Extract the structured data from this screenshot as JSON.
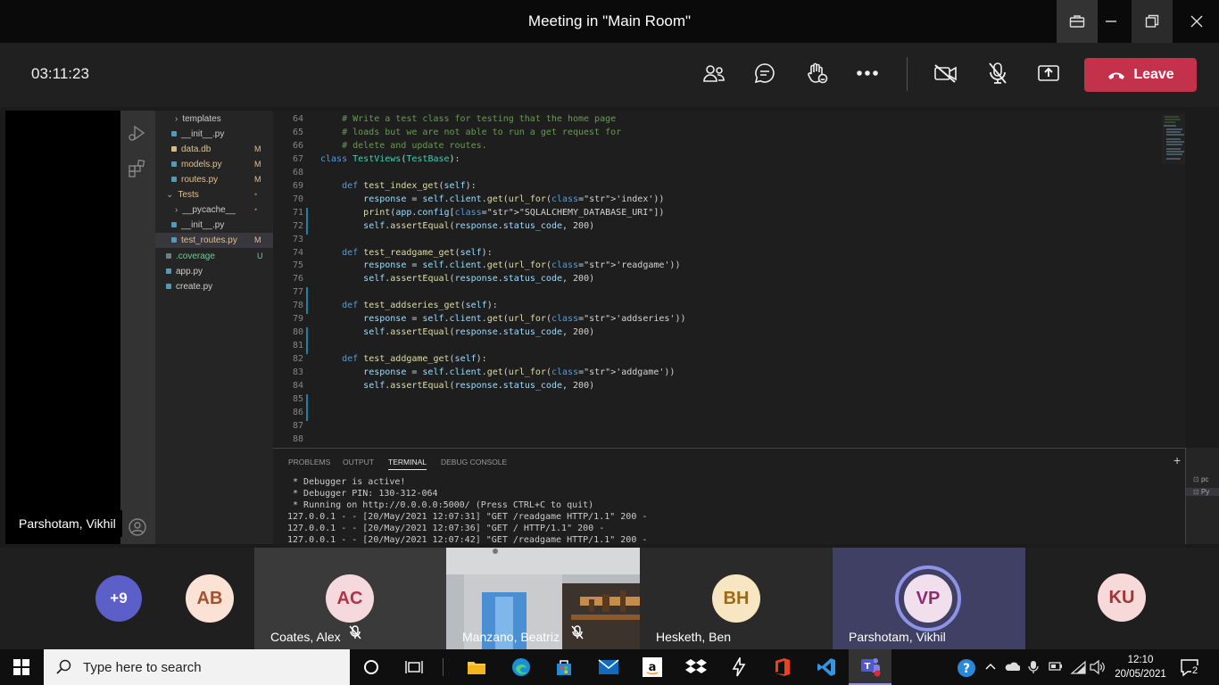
{
  "window": {
    "title": "Meeting in \"Main Room\""
  },
  "controls": {
    "timer": "03:11:23",
    "leave_label": "Leave"
  },
  "presenter": {
    "name": "Parshotam, Vikhil"
  },
  "explorer": {
    "items": [
      {
        "label": "templates",
        "badge": ""
      },
      {
        "label": "__init__.py",
        "badge": ""
      },
      {
        "label": "data.db",
        "badge": "M"
      },
      {
        "label": "models.py",
        "badge": "M"
      },
      {
        "label": "routes.py",
        "badge": "M"
      },
      {
        "label": "Tests",
        "badge": "•"
      },
      {
        "label": "__pycache__",
        "badge": "•"
      },
      {
        "label": "__init__.py",
        "badge": ""
      },
      {
        "label": "test_routes.py",
        "badge": "M"
      },
      {
        "label": ".coverage",
        "badge": "U"
      },
      {
        "label": "app.py",
        "badge": ""
      },
      {
        "label": "create.py",
        "badge": ""
      }
    ]
  },
  "editor": {
    "lines": [
      {
        "n": "64",
        "text": "    # Write a test class for testing that the home page"
      },
      {
        "n": "65",
        "text": "    # loads but we are not able to run a get request for"
      },
      {
        "n": "66",
        "text": "    # delete and update routes."
      },
      {
        "n": "67",
        "text": "class TestViews(TestBase):"
      },
      {
        "n": "68",
        "text": ""
      },
      {
        "n": "69",
        "text": "    def test_index_get(self):"
      },
      {
        "n": "70",
        "text": "        response = self.client.get(url_for('index'))"
      },
      {
        "n": "71",
        "text": "        print(app.config[\"SQLALCHEMY_DATABASE_URI\"])"
      },
      {
        "n": "72",
        "text": "        self.assertEqual(response.status_code, 200)"
      },
      {
        "n": "73",
        "text": ""
      },
      {
        "n": "74",
        "text": "    def test_readgame_get(self):"
      },
      {
        "n": "75",
        "text": "        response = self.client.get(url_for('readgame'))"
      },
      {
        "n": "76",
        "text": "        self.assertEqual(response.status_code, 200)"
      },
      {
        "n": "77",
        "text": ""
      },
      {
        "n": "78",
        "text": "    def test_addseries_get(self):"
      },
      {
        "n": "79",
        "text": "        response = self.client.get(url_for('addseries'))"
      },
      {
        "n": "80",
        "text": "        self.assertEqual(response.status_code, 200)"
      },
      {
        "n": "81",
        "text": ""
      },
      {
        "n": "82",
        "text": "    def test_addgame_get(self):"
      },
      {
        "n": "83",
        "text": "        response = self.client.get(url_for('addgame'))"
      },
      {
        "n": "84",
        "text": "        self.assertEqual(response.status_code, 200)"
      },
      {
        "n": "85",
        "text": ""
      },
      {
        "n": "86",
        "text": ""
      },
      {
        "n": "87",
        "text": ""
      },
      {
        "n": "88",
        "text": ""
      }
    ]
  },
  "panel": {
    "tabs": [
      "PROBLEMS",
      "OUTPUT",
      "TERMINAL",
      "DEBUG CONSOLE"
    ],
    "active_tab": "TERMINAL",
    "terminal": [
      " * Debugger is active!",
      " * Debugger PIN: 130-312-064",
      " * Running on http://0.0.0.0:5000/ (Press CTRL+C to quit)",
      "127.0.0.1 - - [20/May/2021 12:07:31] \"GET /readgame HTTP/1.1\" 200 -",
      "127.0.0.1 - - [20/May/2021 12:07:36] \"GET / HTTP/1.1\" 200 -",
      "127.0.0.1 - - [20/May/2021 12:07:42] \"GET /readgame HTTP/1.1\" 200 -"
    ],
    "side_labels": [
      "pc",
      "Py"
    ]
  },
  "gallery": {
    "overflow": "+9",
    "participants": [
      {
        "initials": "AB",
        "name": ""
      },
      {
        "initials": "AC",
        "name": "Coates, Alex"
      },
      {
        "initials": "",
        "name": "Manzano, Beatriz"
      },
      {
        "initials": "BH",
        "name": "Hesketh, Ben"
      },
      {
        "initials": "VP",
        "name": "Parshotam, Vikhil"
      },
      {
        "initials": "KU",
        "name": ""
      }
    ]
  },
  "taskbar": {
    "search_placeholder": "Type here to search",
    "time": "12:10",
    "date": "20/05/2021",
    "notifications": "2"
  },
  "colors": {
    "leave": "#c4314b",
    "overflow_avatar": "#5b5fc7",
    "avatar_bg": "#fbe2d5"
  }
}
